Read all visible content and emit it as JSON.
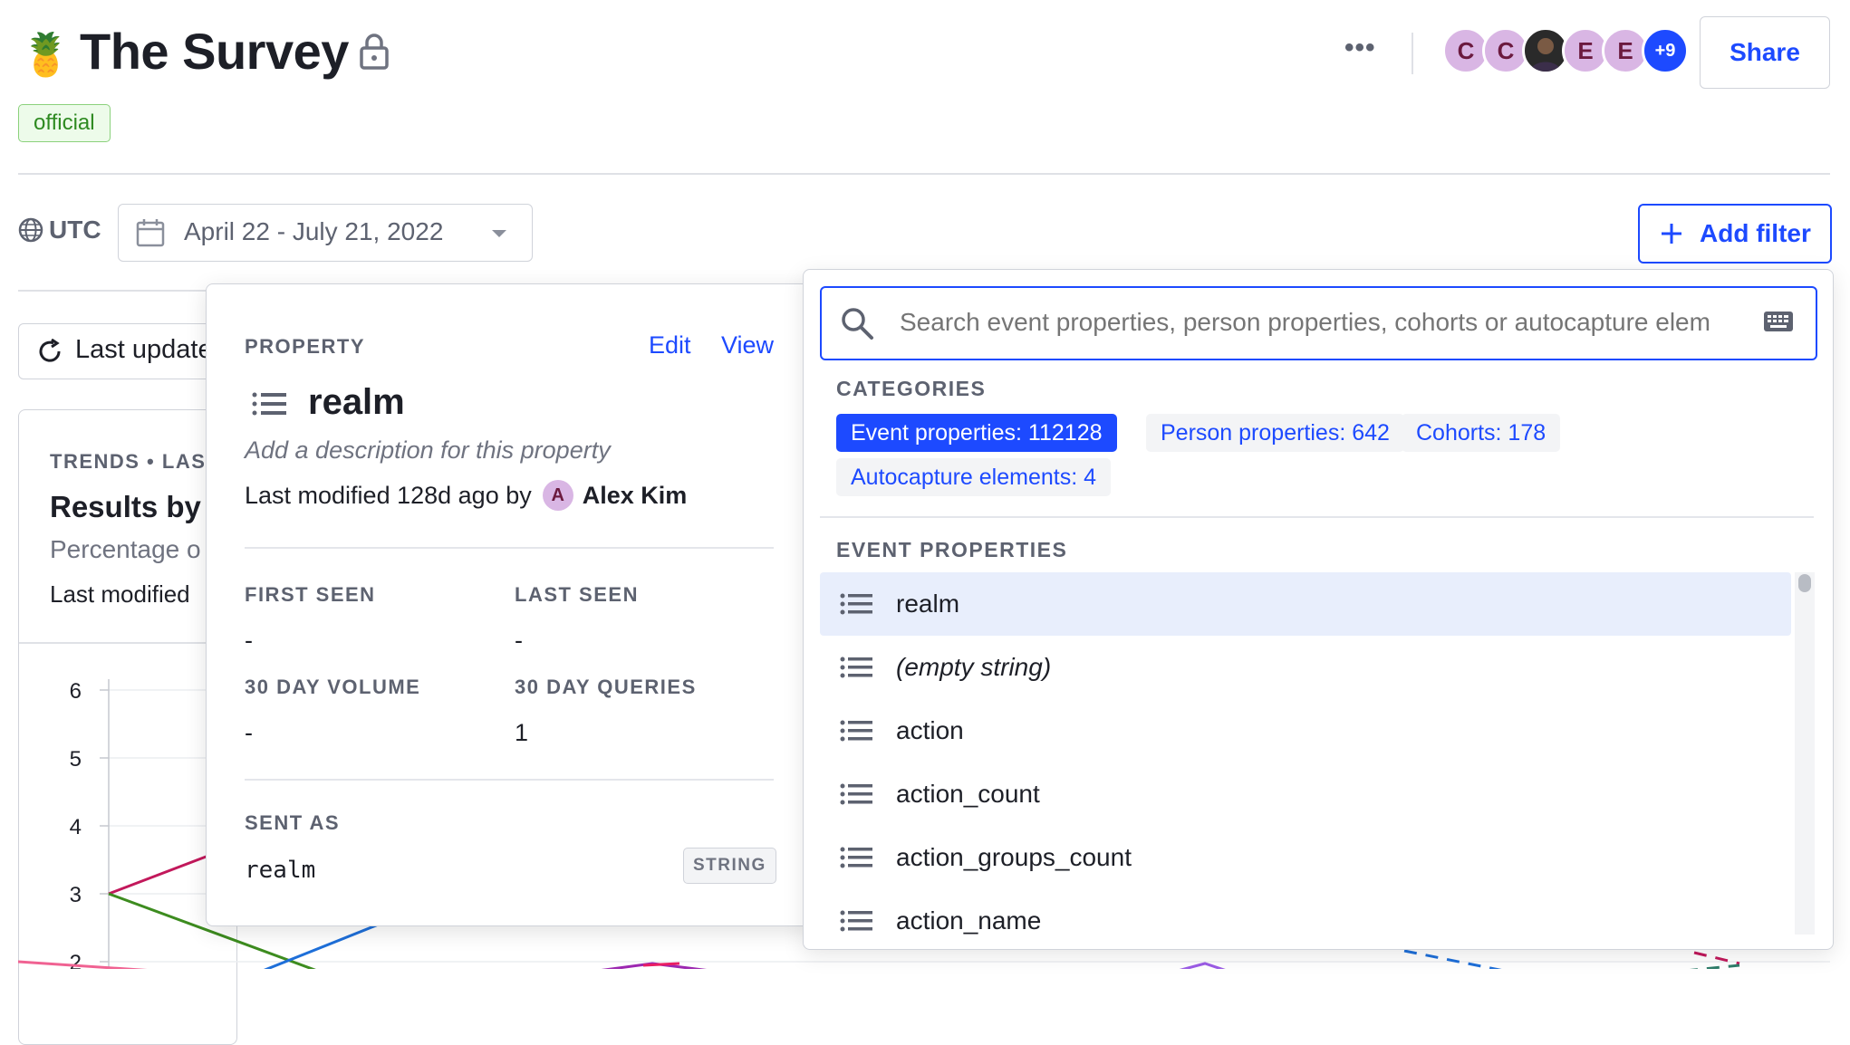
{
  "header": {
    "emoji": "🍍",
    "title": "The Survey",
    "badge": "official",
    "more": "•••",
    "avatars": [
      "C",
      "C",
      "",
      "E",
      "E"
    ],
    "avatars_more": "+9",
    "share": "Share"
  },
  "filters": {
    "timezone": "UTC",
    "date_range": "April 22 - July 21, 2022",
    "add_filter": "Add filter"
  },
  "refresh": {
    "label": "Last updated"
  },
  "insight_card": {
    "subtitle": "TRENDS • LAST",
    "title": "Results by d",
    "description": "Percentage o",
    "last_modified": "Last modified",
    "chart_data": {
      "type": "line",
      "y_ticks": [
        "6",
        "5",
        "4",
        "3",
        "2"
      ],
      "ylim": [
        2,
        6
      ]
    }
  },
  "property_popover": {
    "section": "PROPERTY",
    "edit": "Edit",
    "view": "View",
    "name": "realm",
    "description_placeholder": "Add a description for this property",
    "modified_prefix": "Last modified 128d ago by",
    "author_initial": "A",
    "author": "Alex Kim",
    "first_seen_label": "FIRST SEEN",
    "first_seen": "-",
    "last_seen_label": "LAST SEEN",
    "last_seen": "-",
    "volume_label": "30 DAY VOLUME",
    "volume": "-",
    "queries_label": "30 DAY QUERIES",
    "queries": "1",
    "sent_as_label": "SENT AS",
    "sent_as": "realm",
    "type": "STRING"
  },
  "search_popover": {
    "placeholder": "Search event properties, person properties, cohorts or autocapture elem",
    "categories_label": "CATEGORIES",
    "categories": [
      "Event properties: 112128",
      "Person properties: 642",
      "Cohorts: 178",
      "Autocapture elements: 4"
    ],
    "section_label": "EVENT PROPERTIES",
    "items": [
      "realm",
      "(empty string)",
      "action",
      "action_count",
      "action_groups_count",
      "action_name"
    ]
  },
  "colors": {
    "accent": "#1d4aff",
    "highlight": "#e8eefc",
    "official_bg": "#edfbea",
    "official_text": "#2e8a21"
  }
}
